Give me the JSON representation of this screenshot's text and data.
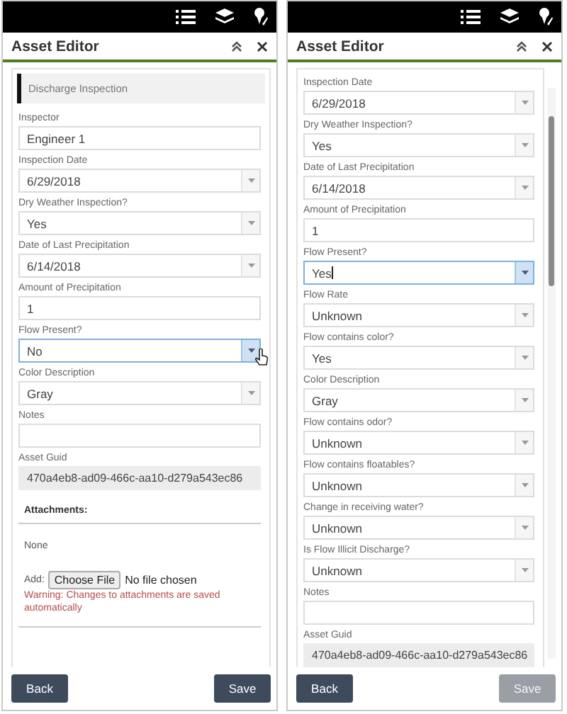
{
  "panels": [
    {
      "title": "Asset Editor",
      "section": "Discharge Inspection",
      "fields": [
        {
          "label": "Inspector",
          "value": "Engineer 1",
          "kind": "text",
          "focused": false
        },
        {
          "label": "Inspection Date",
          "value": "6/29/2018",
          "kind": "select",
          "focused": false
        },
        {
          "label": "Dry Weather Inspection?",
          "value": "Yes",
          "kind": "select",
          "focused": false
        },
        {
          "label": "Date of Last Precipitation",
          "value": "6/14/2018",
          "kind": "select",
          "focused": false
        },
        {
          "label": "Amount of Precipitation",
          "value": "1",
          "kind": "text",
          "focused": false
        },
        {
          "label": "Flow Present?",
          "value": "No",
          "kind": "select",
          "focused": true,
          "pointer": true
        },
        {
          "label": "Color Description",
          "value": "Gray",
          "kind": "select",
          "focused": false
        },
        {
          "label": "Notes",
          "kind": "text",
          "focused": false
        },
        {
          "label": "Asset Guid",
          "value": "470a4eb8-ad09-466c-aa10-d279a543ec86",
          "kind": "readonly",
          "focused": false
        }
      ],
      "attachments": {
        "heading": "Attachments:",
        "list": "None",
        "add_label": "Add:",
        "file_button": "Choose File",
        "file_status": "No file chosen",
        "warning": "Warning: Changes to attachments are saved automatically"
      },
      "buttons": [
        {
          "label": "Back",
          "disabled": false
        },
        {
          "label": "Save",
          "disabled": false
        }
      ]
    },
    {
      "title": "Asset Editor",
      "scrollbar": true,
      "fields": [
        {
          "label": "Inspection Date",
          "value": "6/29/2018",
          "kind": "select",
          "focused": false
        },
        {
          "label": "Dry Weather Inspection?",
          "value": "Yes",
          "kind": "select",
          "focused": false
        },
        {
          "label": "Date of Last Precipitation",
          "value": "6/14/2018",
          "kind": "select",
          "focused": false
        },
        {
          "label": "Amount of Precipitation",
          "value": "1",
          "kind": "text",
          "focused": false
        },
        {
          "label": "Flow Present?",
          "value": "Yes",
          "kind": "select",
          "focused": true,
          "text_cursor": true
        },
        {
          "label": "Flow Rate",
          "value": "Unknown",
          "kind": "select",
          "focused": false
        },
        {
          "label": "Flow contains color?",
          "value": "Yes",
          "kind": "select",
          "focused": false
        },
        {
          "label": "Color Description",
          "value": "Gray",
          "kind": "select",
          "focused": false
        },
        {
          "label": "Flow contains odor?",
          "value": "Unknown",
          "kind": "select",
          "focused": false
        },
        {
          "label": "Flow contains floatables?",
          "value": "Unknown",
          "kind": "select",
          "focused": false
        },
        {
          "label": "Change in receiving water?",
          "value": "Unknown",
          "kind": "select",
          "focused": false
        },
        {
          "label": "Is Flow Illicit Discharge?",
          "value": "Unknown",
          "kind": "select",
          "focused": false
        },
        {
          "label": "Notes",
          "kind": "text",
          "focused": false
        },
        {
          "label": "Asset Guid",
          "value": "470a4eb8-ad09-466c-aa10-d279a543ec86",
          "kind": "readonly",
          "focused": false
        }
      ],
      "buttons": [
        {
          "label": "Back",
          "disabled": false
        },
        {
          "label": "Save",
          "disabled": true
        }
      ]
    }
  ]
}
